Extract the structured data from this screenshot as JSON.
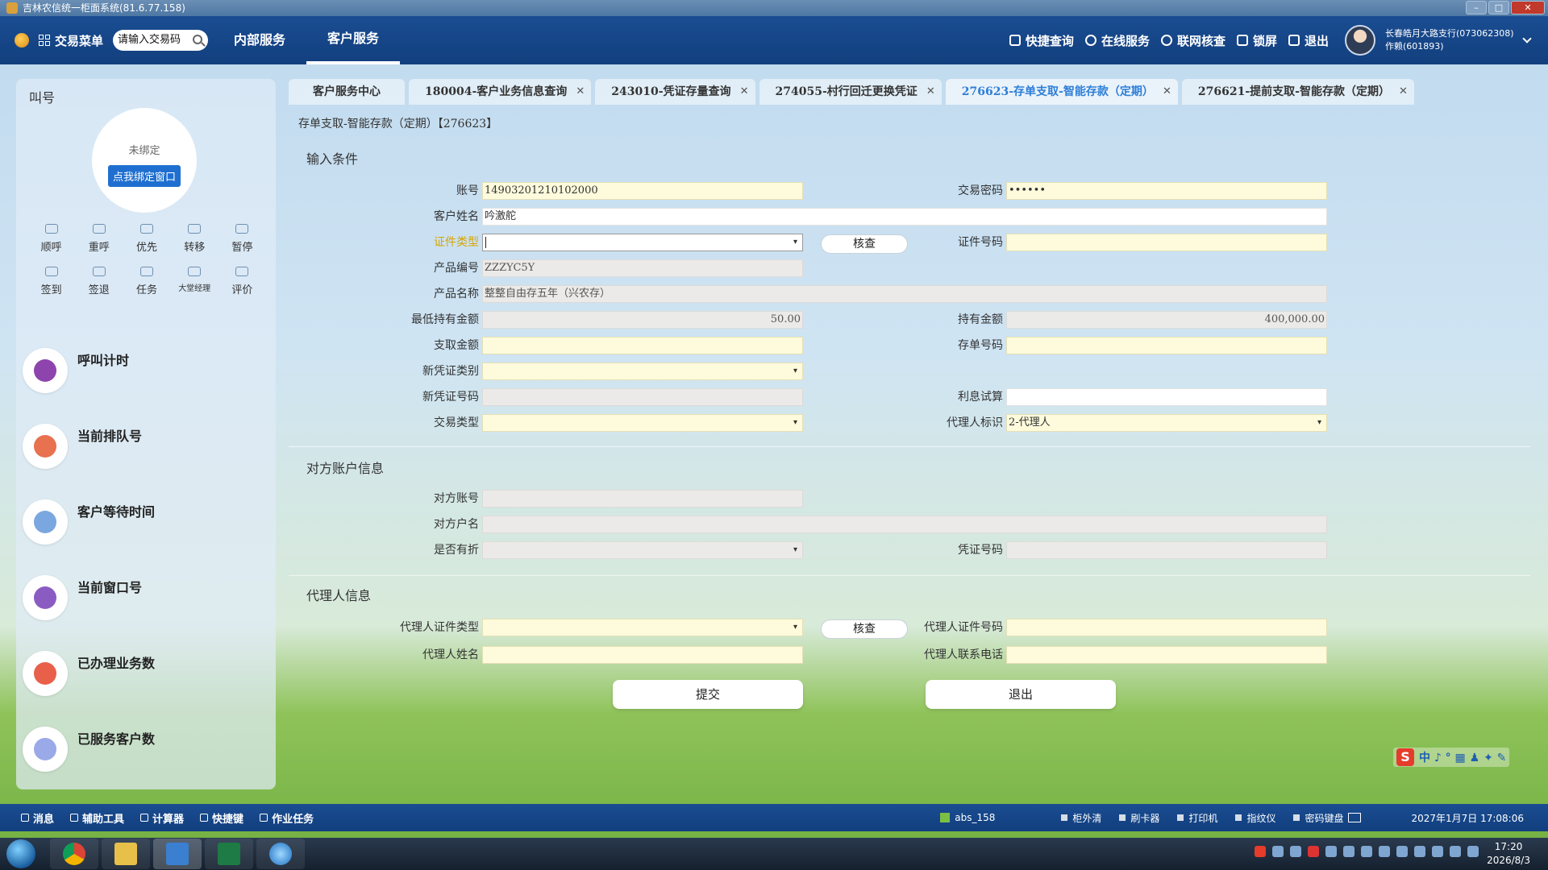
{
  "window": {
    "title": "吉林农信统一柜面系统(81.6.77.158)"
  },
  "navbar": {
    "menu_label": "交易菜单",
    "search_placeholder": "请输入交易码",
    "tabs": [
      "内部服务",
      "客户服务"
    ],
    "tools": [
      "快捷查询",
      "在线服务",
      "联网核查",
      "锁屏",
      "退出"
    ],
    "user_line1": "长春皓月大路支行(073062308)",
    "user_line2": "作赖(601893)"
  },
  "left_panel": {
    "title": "叫号",
    "unbound": "未绑定",
    "bind_button": "点我绑定窗口",
    "actions": [
      "顺呼",
      "重呼",
      "优先",
      "转移",
      "暂停",
      "签到",
      "签退",
      "任务",
      "大堂经理",
      "评价"
    ],
    "stats": [
      "呼叫计时",
      "当前排队号",
      "客户等待时间",
      "当前窗口号",
      "已办理业务数",
      "已服务客户数"
    ],
    "stat_colors": [
      "#8e44ad",
      "#e8714f",
      "#7aa7e0",
      "#8a5cc2",
      "#e8604a",
      "#9aa9e8"
    ]
  },
  "tabs": [
    {
      "label": "客户服务中心",
      "closable": false,
      "active": false
    },
    {
      "label": "180004-客户业务信息查询",
      "closable": true,
      "active": false
    },
    {
      "label": "243010-凭证存量查询",
      "closable": true,
      "active": false
    },
    {
      "label": "274055-村行回迁更换凭证",
      "closable": true,
      "active": false
    },
    {
      "label": "276623-存单支取-智能存款（定期）",
      "closable": true,
      "active": true
    },
    {
      "label": "276621-提前支取-智能存款（定期）",
      "closable": true,
      "active": false
    }
  ],
  "breadcrumb": "存单支取-智能存款（定期）【276623】",
  "form": {
    "sections": {
      "input": "输入条件",
      "counterparty": "对方账户信息",
      "agent": "代理人信息"
    },
    "labels": {
      "account": "账号",
      "password": "交易密码",
      "customer_name": "客户姓名",
      "id_type": "证件类型",
      "id_number": "证件号码",
      "product_code": "产品编号",
      "product_name": "产品名称",
      "min_holding": "最低持有金额",
      "holding": "持有金额",
      "withdraw_amount": "支取金额",
      "deposit_no": "存单号码",
      "new_voucher_type": "新凭证类别",
      "new_voucher_no": "新凭证号码",
      "interest_calc": "利息试算",
      "transaction_type": "交易类型",
      "agent_flag": "代理人标识",
      "cp_account": "对方账号",
      "cp_name": "对方户名",
      "has_passbook": "是否有折",
      "voucher_no": "凭证号码",
      "agent_id_type": "代理人证件类型",
      "agent_id_no": "代理人证件号码",
      "agent_name": "代理人姓名",
      "agent_phone": "代理人联系电话"
    },
    "values": {
      "account": "14903201210102000",
      "password": "••••••",
      "customer_name": "吟激舵",
      "product_code": "ZZZYC5Y",
      "product_name": "整整自由存五年（兴农存）",
      "min_holding": "50.00",
      "holding": "400,000.00",
      "agent_flag": "2-代理人"
    },
    "buttons": {
      "verify": "核查",
      "submit": "提交",
      "exit": "退出"
    }
  },
  "ime": {
    "glyphs": "中 ♪ ° ▦ ♟ ✦ ✎"
  },
  "statusbar": {
    "items": [
      "消息",
      "辅助工具",
      "计算器",
      "快捷键",
      "作业任务"
    ],
    "abs": "abs_158",
    "devices": [
      "柜外清",
      "刷卡器",
      "打印机",
      "指纹仪",
      "密码键盘"
    ],
    "datetime": "2027年1月7日 17:08:06"
  },
  "taskbar": {
    "time": "17:20",
    "date": "2026/8/3"
  }
}
